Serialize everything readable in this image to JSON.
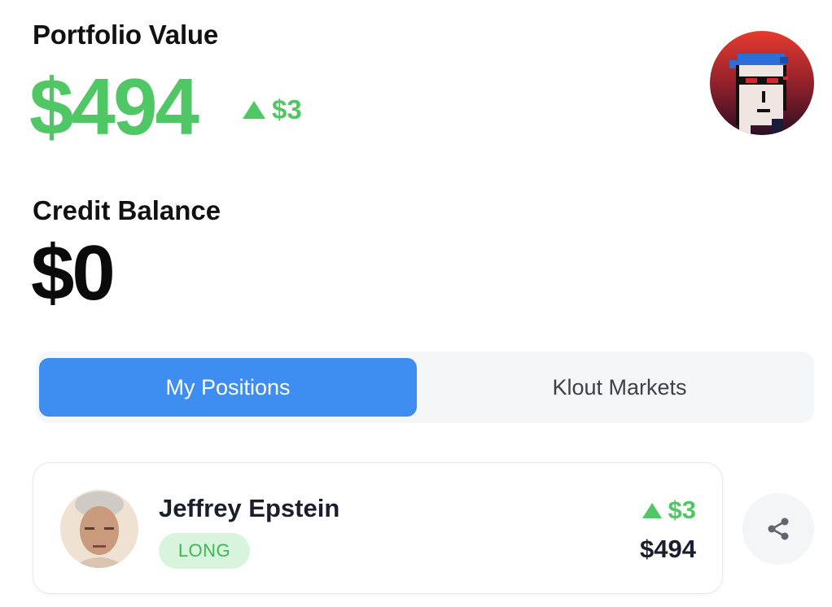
{
  "portfolio": {
    "title": "Portfolio Value",
    "value": "$494",
    "change": "$3",
    "accent_color": "#4fc765"
  },
  "profile": {
    "avatar_icon": "pixel-punk-avatar-icon"
  },
  "credit": {
    "title": "Credit Balance",
    "value": "$0"
  },
  "tabs": [
    {
      "label": "My Positions",
      "active": true
    },
    {
      "label": "Klout Markets",
      "active": false
    }
  ],
  "positions": [
    {
      "name": "Jeffrey Epstein",
      "side": "LONG",
      "change": "$3",
      "value": "$494"
    }
  ],
  "actions": {
    "share_icon": "share-icon"
  },
  "colors": {
    "tab_active": "#3d8ef0",
    "positive": "#4fc765",
    "badge_bg": "#d9f4dd"
  }
}
